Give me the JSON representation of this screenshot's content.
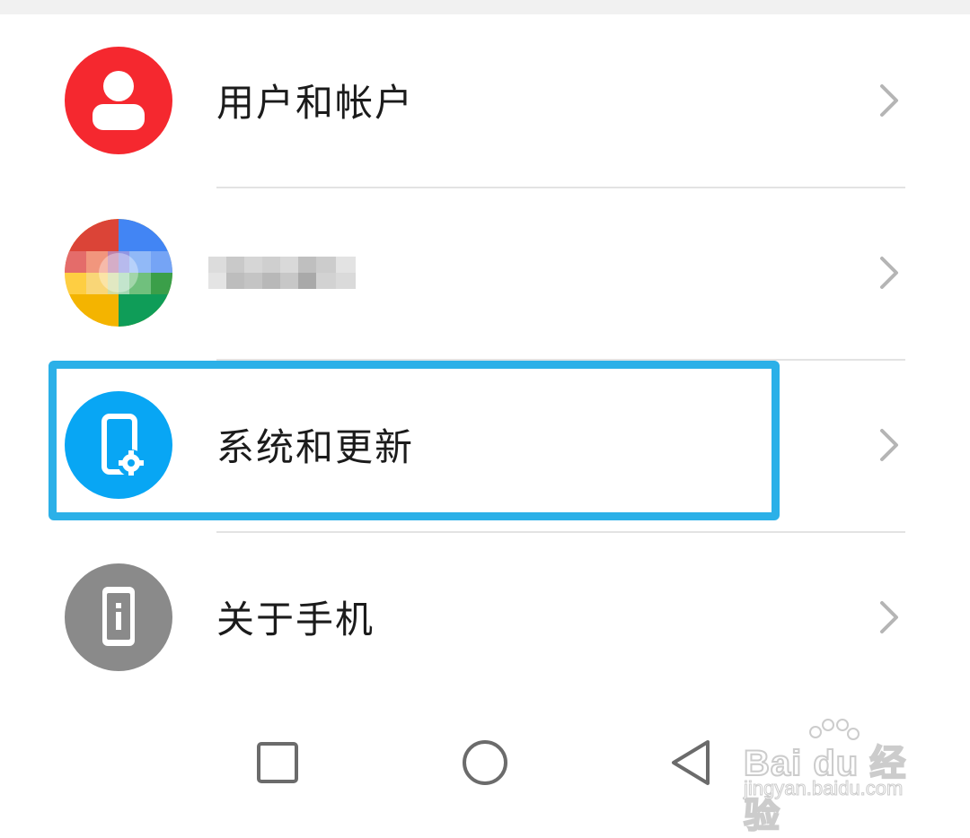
{
  "settings": {
    "items": [
      {
        "label": "用户和帐户",
        "icon": "user-icon",
        "icon_color": "#f5282f"
      },
      {
        "label": "",
        "icon": "google-icon",
        "icon_color": "#4285f4"
      },
      {
        "label": "系统和更新",
        "icon": "phone-settings-icon",
        "icon_color": "#08a6f4"
      },
      {
        "label": "关于手机",
        "icon": "phone-info-icon",
        "icon_color": "#8a8a8a"
      }
    ]
  },
  "highlight": {
    "color": "#2bb0e8",
    "target": "系统和更新"
  },
  "navbar": {
    "buttons": [
      "recent-apps",
      "home",
      "back"
    ]
  },
  "watermark": {
    "brand": "Bai du 经验",
    "url": "jingyan.baidu.com"
  }
}
